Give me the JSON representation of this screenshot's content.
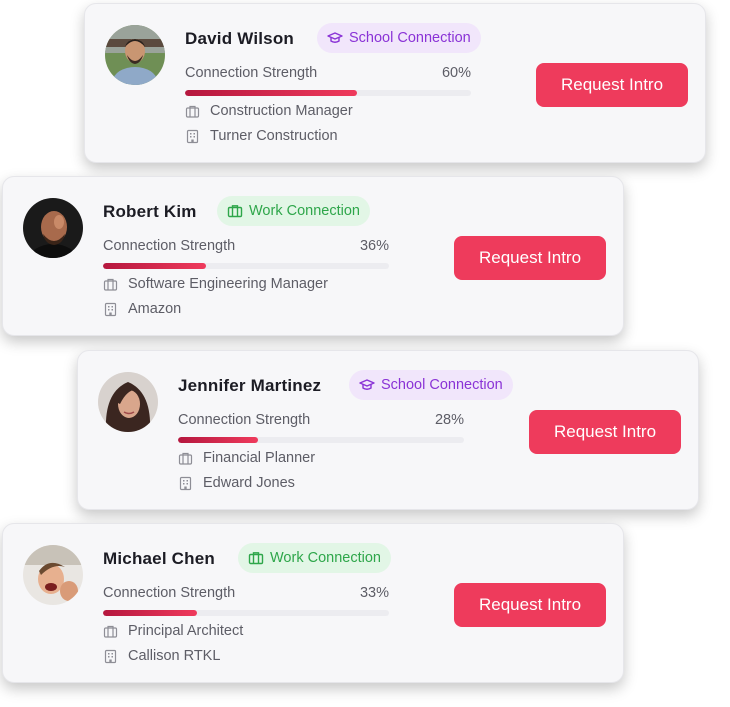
{
  "cards": [
    {
      "name": "David Wilson",
      "badge": "School Connection",
      "strength_label": "Connection Strength",
      "strength_pct": "60%",
      "strength_value": 0.6,
      "role": "Construction Manager",
      "company": "Turner Construction",
      "button": "Request Intro"
    },
    {
      "name": "Robert Kim",
      "badge": "Work Connection",
      "strength_label": "Connection Strength",
      "strength_pct": "36%",
      "strength_value": 0.36,
      "role": "Software Engineering Manager",
      "company": "Amazon",
      "button": "Request Intro"
    },
    {
      "name": "Jennifer Martinez",
      "badge": "School Connection",
      "strength_label": "Connection Strength",
      "strength_pct": "28%",
      "strength_value": 0.28,
      "role": "Financial Planner",
      "company": "Edward Jones",
      "button": "Request Intro"
    },
    {
      "name": "Michael Chen",
      "badge": "Work Connection",
      "strength_label": "Connection Strength",
      "strength_pct": "33%",
      "strength_value": 0.33,
      "role": "Principal Architect",
      "company": "Callison RTKL",
      "button": "Request Intro"
    }
  ],
  "colors": {
    "accent": "#ee3b5c",
    "school_badge_bg": "#f1e6fb",
    "school_badge_text": "#8a33d6",
    "work_badge_bg": "#e2f6e6",
    "work_badge_text": "#2ea64a",
    "bar_start": "#b5173e",
    "bar_end": "#ef3a5c"
  }
}
